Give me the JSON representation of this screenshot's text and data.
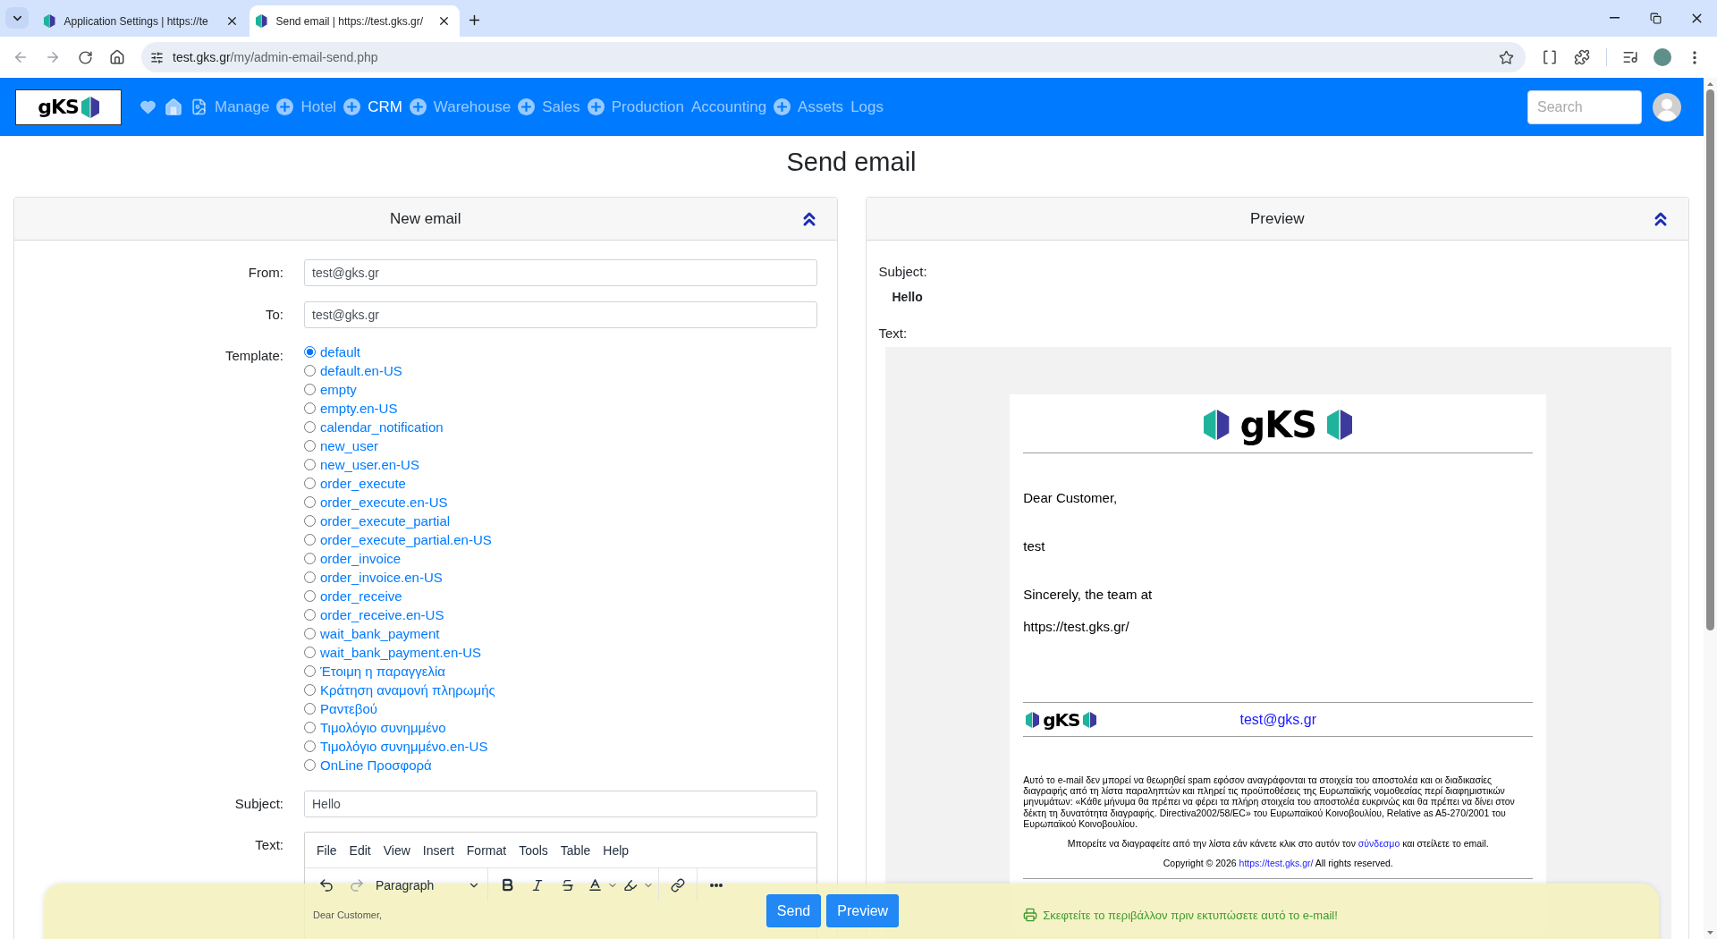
{
  "browser": {
    "tabs": [
      {
        "title": "Application Settings | https://te",
        "selected": false
      },
      {
        "title": "Send email | https://test.gks.gr/",
        "selected": true
      }
    ],
    "url": {
      "host": "test.gks.gr",
      "path": "/my/admin-email-send.php"
    }
  },
  "navbar": {
    "logo_text": "gKS",
    "items": [
      {
        "label": "Manage",
        "selected": false,
        "add_button": true
      },
      {
        "label": "Hotel",
        "selected": false,
        "add_button": true
      },
      {
        "label": "CRM",
        "selected": true,
        "add_button": true
      },
      {
        "label": "Warehouse",
        "selected": false,
        "add_button": true
      },
      {
        "label": "Sales",
        "selected": false,
        "add_button": true
      },
      {
        "label": "Production",
        "selected": false,
        "add_button": false
      },
      {
        "label": "Accounting",
        "selected": false,
        "add_button": true
      },
      {
        "label": "Assets",
        "selected": false,
        "add_button": false
      },
      {
        "label": "Logs",
        "selected": false,
        "add_button": false
      }
    ],
    "search": {
      "placeholder": "Search"
    }
  },
  "page_title": "Send email",
  "compose": {
    "title": "New email",
    "fields": [
      {
        "label": "From:",
        "value": "test@gks.gr"
      },
      {
        "label": "To:",
        "value": "test@gks.gr"
      }
    ],
    "template": {
      "label": "Template:",
      "options": [
        {
          "label": "default",
          "selected": true
        },
        {
          "label": "default.en-US",
          "selected": false
        },
        {
          "label": "empty",
          "selected": false
        },
        {
          "label": "empty.en-US",
          "selected": false
        },
        {
          "label": "calendar_notification",
          "selected": false
        },
        {
          "label": "new_user",
          "selected": false
        },
        {
          "label": "new_user.en-US",
          "selected": false
        },
        {
          "label": "order_execute",
          "selected": false
        },
        {
          "label": "order_execute.en-US",
          "selected": false
        },
        {
          "label": "order_execute_partial",
          "selected": false
        },
        {
          "label": "order_execute_partial.en-US",
          "selected": false
        },
        {
          "label": "order_invoice",
          "selected": false
        },
        {
          "label": "order_invoice.en-US",
          "selected": false
        },
        {
          "label": "order_receive",
          "selected": false
        },
        {
          "label": "order_receive.en-US",
          "selected": false
        },
        {
          "label": "wait_bank_payment",
          "selected": false
        },
        {
          "label": "wait_bank_payment.en-US",
          "selected": false
        },
        {
          "label": "Έτοιμη η παραγγελία",
          "selected": false
        },
        {
          "label": "Κράτηση αναμονή πληρωμής",
          "selected": false
        },
        {
          "label": "Ραντεβού",
          "selected": false
        },
        {
          "label": "Τιμολόγιο συνημμένο",
          "selected": false
        },
        {
          "label": "Τιμολόγιο συνημμένο.en-US",
          "selected": false
        },
        {
          "label": "OnLine Προσφορά",
          "selected": false
        }
      ]
    },
    "subject": {
      "label": "Subject:",
      "value": "Hello"
    },
    "text": {
      "label": "Text:",
      "menu": [
        "File",
        "Edit",
        "View",
        "Insert",
        "Format",
        "Tools",
        "Table",
        "Help"
      ],
      "block_format": "Paragraph",
      "content": [
        "Dear Customer,"
      ]
    }
  },
  "preview": {
    "title": "Preview",
    "subject_label": "Subject:",
    "subject": "Hello",
    "text_label": "Text:",
    "email": {
      "logo_text": "gKS",
      "paragraphs": [
        "Dear Customer,",
        "test",
        "Sincerely, the team at",
        "https://test.gks.gr/"
      ],
      "footer_logo_text": "gKS",
      "contact_email": "test@gks.gr",
      "disclaimer": "Αυτό το e-mail δεν μπορεί να θεωρηθεί spam εφόσον αναγράφονται τα στοιχεία του αποστολέα και οι διαδικασίες διαγραφής από τη λίστα παραληπτών και πληρεί τις προϋποθέσεις της Ευρωπαϊκής νομοθεσίας περί διαφημιστικών μηνυμάτων: «Κάθε μήνυμα θα πρέπει να φέρει τα πλήρη στοιχεία του αποστολέα ευκρινώς και θα πρέπει να δίνει στον δέκτη τη δυνατότητα διαγραφής. Directiva2002/58/EC» του Ευρωπαϊκού Κοινοβουλίου, Relative as A5-270/2001 του Ευρωπαϊκού Κοινοβουλίου.",
      "unsubscribe": {
        "before": "Μπορείτε να διαγραφείτε από την λίστα εάν κάνετε κλικ στο αυτόν τον",
        "link": "σύνδεσμο",
        "after": "και στείλετε το email."
      },
      "copyright": {
        "before": "Copyright © 2026",
        "link": "https://test.gks.gr/",
        "after": "All rights reserved."
      },
      "eco_note": "Σκεφτείτε το περιβάλλον πριν εκτυπώσετε αυτό το e-mail!"
    }
  },
  "actions": [
    {
      "label": "Send"
    },
    {
      "label": "Preview"
    }
  ]
}
